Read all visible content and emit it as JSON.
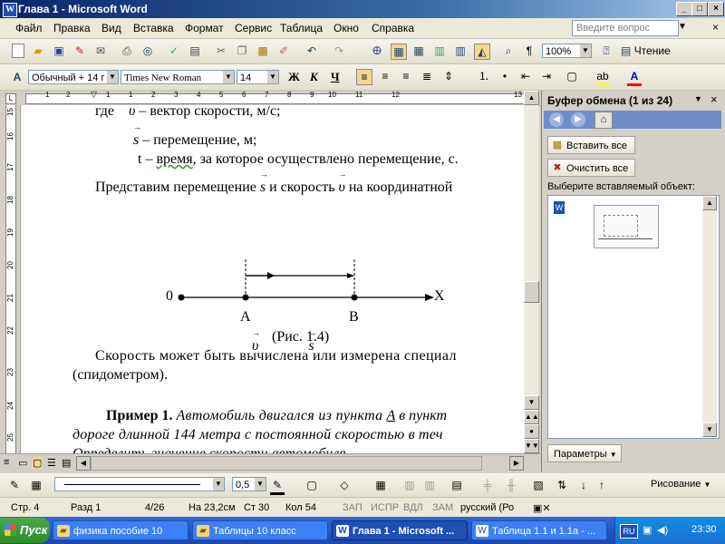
{
  "window": {
    "title": "Глава 1 - Microsoft Word",
    "app_icon": "word-icon",
    "buttons": {
      "minimize": "_",
      "maximize": "□",
      "close": "×"
    }
  },
  "menu": {
    "items": [
      "Файл",
      "Правка",
      "Вид",
      "Вставка",
      "Формат",
      "Сервис",
      "Таблица",
      "Окно",
      "Справка"
    ],
    "ask_placeholder": "Введите вопрос"
  },
  "toolbar_standard": {
    "zoom": "100%",
    "read_label": "Чтение"
  },
  "toolbar_format": {
    "style": "Обычный + 14 г",
    "font": "Times New Roman",
    "size": "14",
    "bold": "Ж",
    "italic": "К",
    "underline": "Ч"
  },
  "ruler": {
    "numbers": [
      "1",
      "2",
      "1",
      "1",
      "2",
      "3",
      "4",
      "5",
      "6",
      "7",
      "8",
      "9",
      "10",
      "11",
      "12",
      "13"
    ]
  },
  "vruler": {
    "numbers": [
      "15",
      "16",
      "17",
      "18",
      "19",
      "20",
      "21",
      "22",
      "23",
      "24",
      "25"
    ]
  },
  "document": {
    "line1_a": "где",
    "line1_vec": "υ",
    "line1_b": "– вектор скорости, м/с;",
    "line2_vec": "s",
    "line2_b": "– перемещение, м;",
    "line3_a": "t",
    "line3_b": "–",
    "line3_wavy": "время",
    "line3_c": ", за которое осуществлено перемещение, с.",
    "line4_a": "Представим перемещение",
    "line4_vec1": "s",
    "line4_b": "и скорость",
    "line4_vec2": "υ",
    "line4_c": "на координатной",
    "figure": {
      "v_label": "υ",
      "s_label": "s",
      "origin": "0",
      "axis": "X",
      "point_a": "A",
      "point_b": "B",
      "caption": "(Рис. 1.4)"
    },
    "line5": "Скорость может быть вычислена или измерена специал",
    "line6": "(спидометром).",
    "example_label": "Пример 1.",
    "example_l1_a": "Автомобиль двигался из пункта",
    "example_l1_u": "А",
    "example_l1_b": "в пункт",
    "example_l2": "дороге длинной 144 метра с постоянной скоростью в теч",
    "example_l3": "Определить значение скорости автомобиля."
  },
  "taskpane": {
    "title": "Буфер обмена (1 из 24)",
    "paste_all": "Вставить все",
    "clear_all": "Очистить все",
    "hint": "Выберите вставляемый объект:",
    "params": "Параметры"
  },
  "drawbar": {
    "line_width": "0,5",
    "draw_label": "Рисование"
  },
  "status": {
    "page": "Стр. 4",
    "section": "Разд 1",
    "pages": "4/26",
    "at": "На 23,2см",
    "line": "Ст 30",
    "col": "Кол 54",
    "rec": "ЗАП",
    "trk": "ИСПР",
    "ext": "ВДЛ",
    "ovr": "ЗАМ",
    "lang": "русский (Ро"
  },
  "taskbar": {
    "start": "Пуск",
    "tasks": [
      {
        "label": "физика пособие 10",
        "icon": "folder-icon",
        "active": false
      },
      {
        "label": "Таблицы 10 класс",
        "icon": "folder-icon",
        "active": false
      },
      {
        "label": "Глава 1 - Microsoft ...",
        "icon": "word-icon",
        "active": true
      },
      {
        "label": "Таблица 1.1 и 1.1а - ...",
        "icon": "word-icon",
        "active": false
      }
    ],
    "lang": "RU",
    "clock": "23:30"
  }
}
